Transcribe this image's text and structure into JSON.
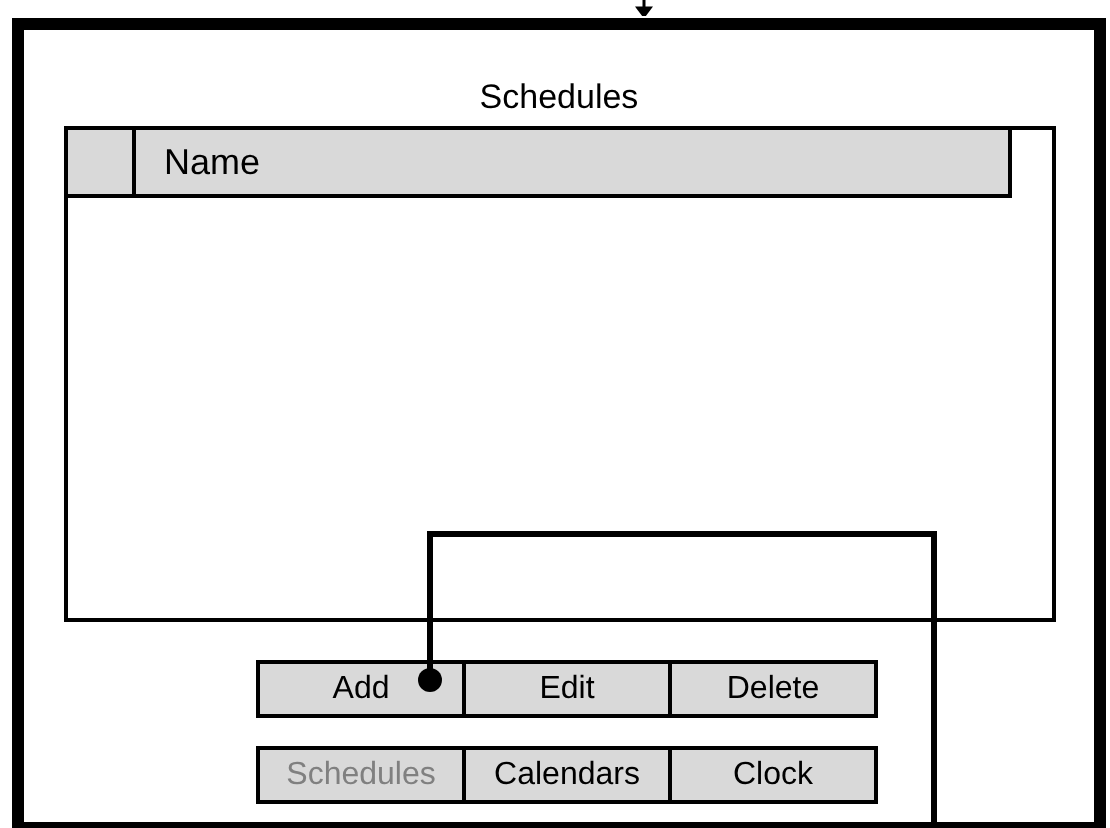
{
  "window": {
    "title": "Schedules"
  },
  "table": {
    "columns": [
      "Name"
    ]
  },
  "buttons": [
    "Add",
    "Edit",
    "Delete"
  ],
  "tabs": [
    {
      "label": "Schedules",
      "selected": true
    },
    {
      "label": "Calendars",
      "selected": false
    },
    {
      "label": "Clock",
      "selected": false
    }
  ]
}
